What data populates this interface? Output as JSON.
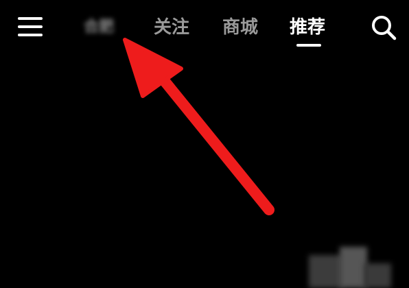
{
  "topbar": {
    "menu_icon": "hamburger-menu-icon",
    "tabs": [
      {
        "label": "合肥"
      },
      {
        "label": "关注"
      },
      {
        "label": "商城"
      },
      {
        "label": "推荐"
      }
    ],
    "active_tab_index": 3,
    "search_icon": "search-icon"
  },
  "colors": {
    "background": "#000000",
    "active_tab": "#ffffff",
    "inactive_tab": "#9a9a9a",
    "annotation_arrow": "#ee1c1c"
  }
}
